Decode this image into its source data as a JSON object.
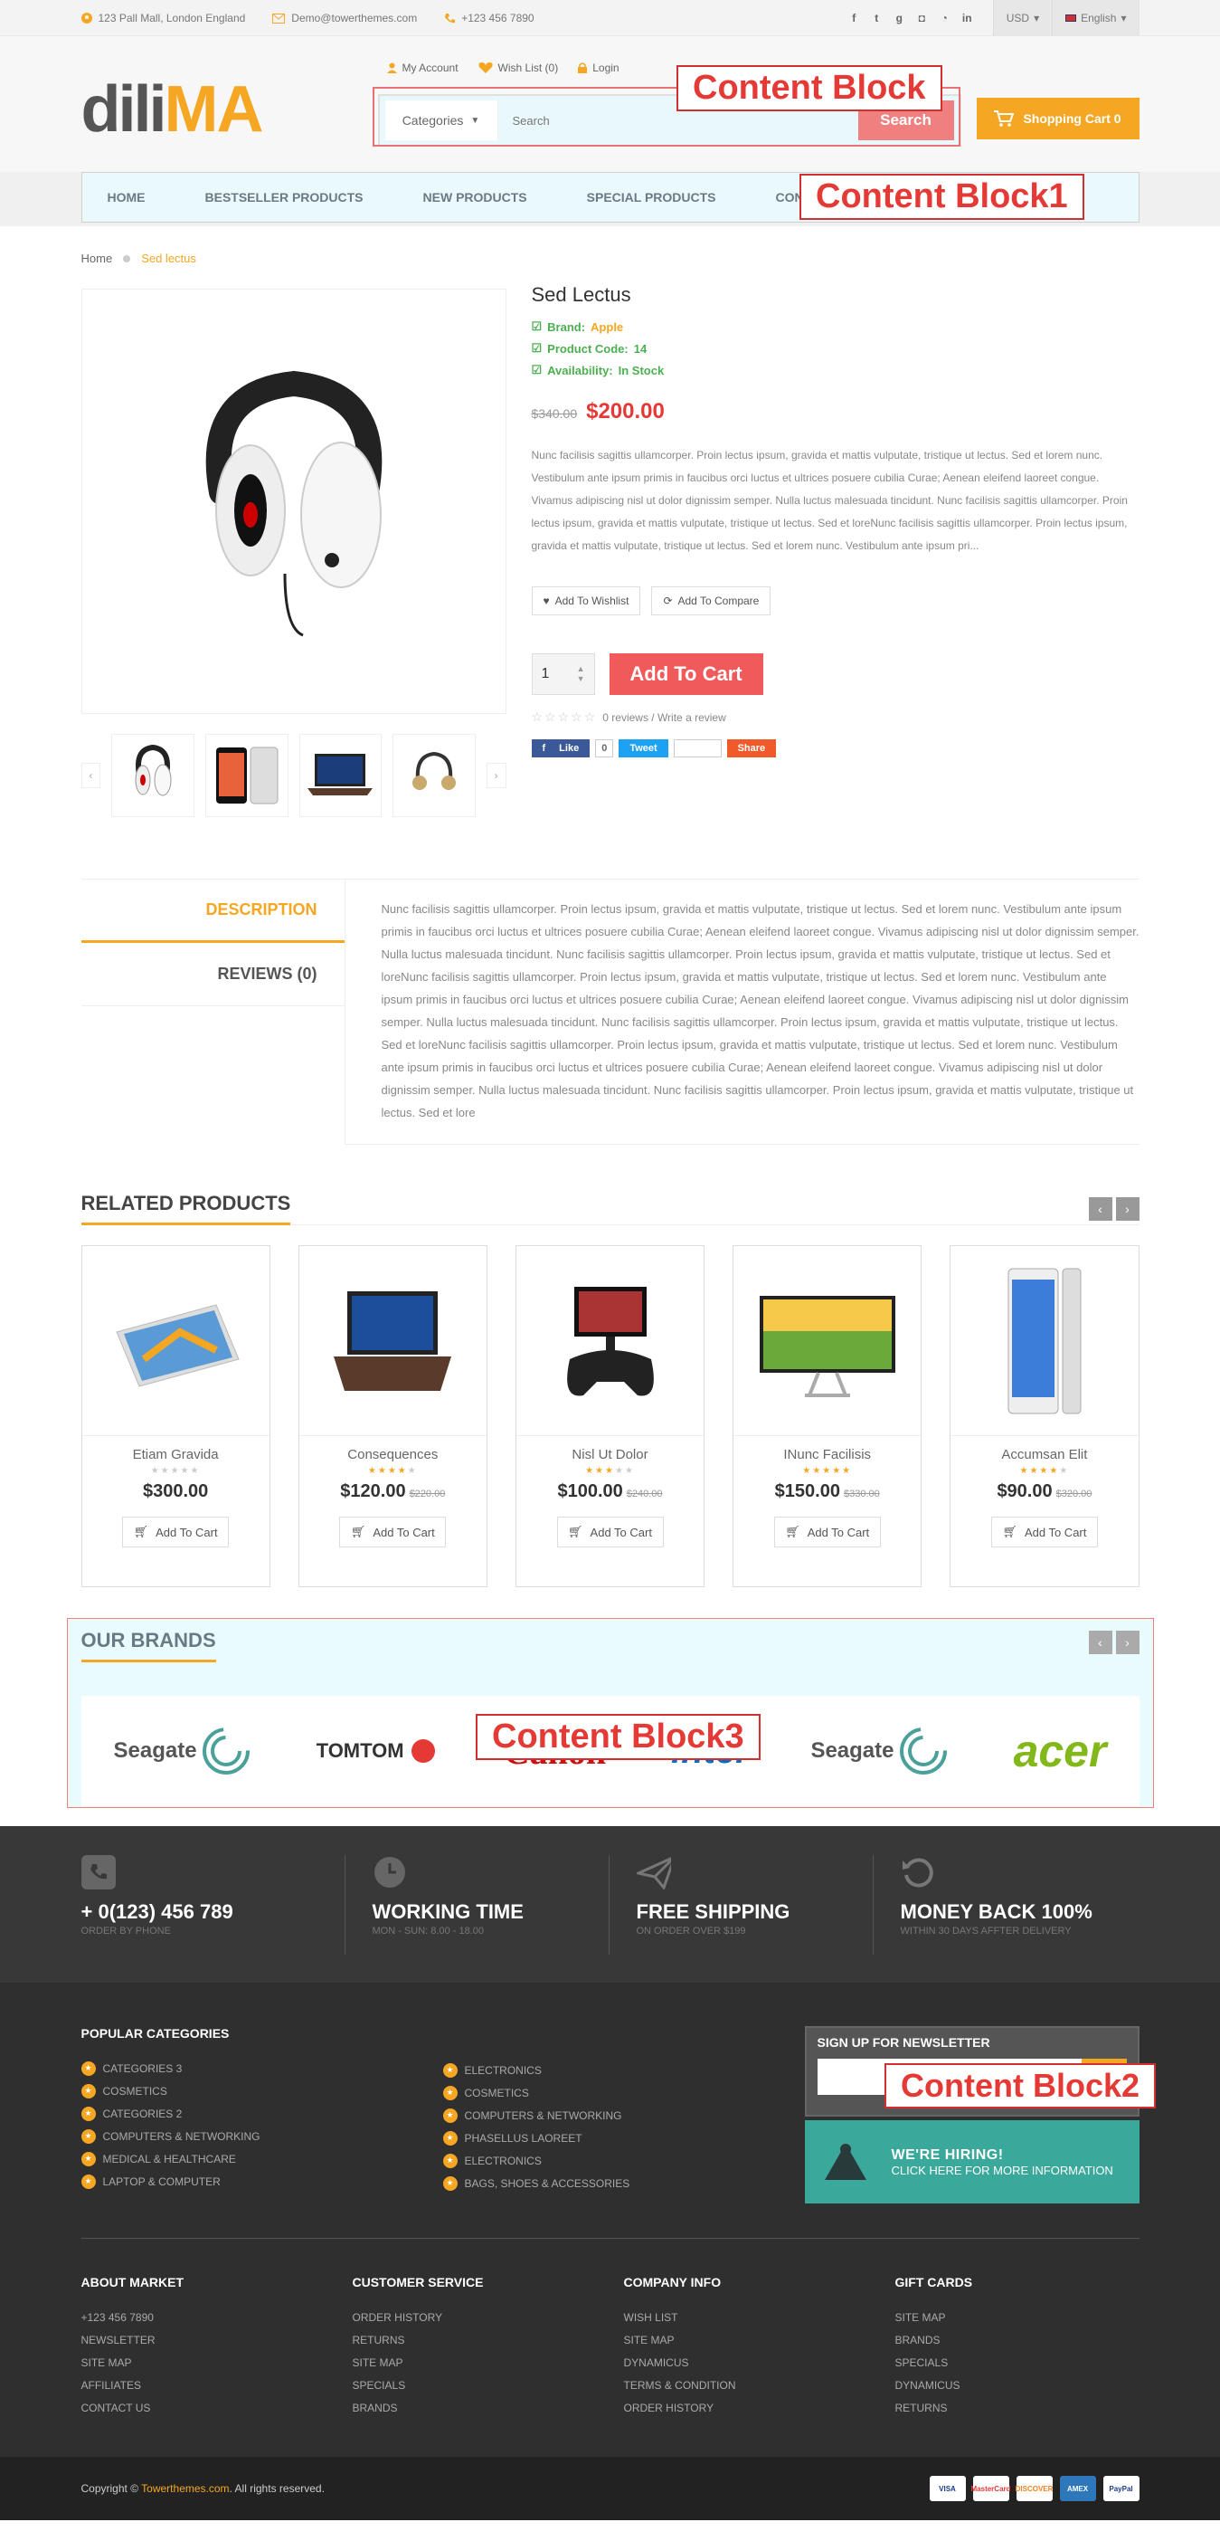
{
  "topbar": {
    "address": "123 Pall Mall, London England",
    "email": "Demo@towerthemes.com",
    "phone": "+123 456 7890",
    "currency": "USD",
    "language": "English",
    "social_icons": [
      "facebook-icon",
      "twitter-icon",
      "google-plus-icon",
      "instagram-icon",
      "rss-icon",
      "linkedin-icon"
    ]
  },
  "header": {
    "logo_text_a": "dili",
    "logo_text_b": "MA",
    "links": {
      "account": "My Account",
      "wishlist": "Wish List (0)",
      "login": "Login"
    },
    "search": {
      "category": "Categories",
      "placeholder": "Search",
      "button": "Search"
    },
    "cart": "Shopping Cart 0"
  },
  "nav": [
    "HOME",
    "BESTSELLER PRODUCTS",
    "NEW PRODUCTS",
    "SPECIAL PRODUCTS",
    "CONTACT US"
  ],
  "annotations": {
    "block": "Content Block",
    "block1": "Content Block1",
    "block2": "Content Block2",
    "block3": "Content Block3"
  },
  "breadcrumb": {
    "home": "Home",
    "current": "Sed lectus"
  },
  "product": {
    "title": "Sed Lectus",
    "brand_label": "Brand:",
    "brand": "Apple",
    "code_label": "Product Code:",
    "code": "14",
    "avail_label": "Availability:",
    "avail": "In Stock",
    "old_price": "$340.00",
    "price": "$200.00",
    "description": "Nunc facilisis sagittis ullamcorper. Proin lectus ipsum, gravida et mattis vulputate, tristique ut lectus. Sed et lorem nunc. Vestibulum ante ipsum primis in faucibus orci luctus et ultrices posuere cubilia Curae; Aenean eleifend laoreet congue. Vivamus adipiscing nisl ut dolor dignissim semper. Nulla luctus malesuada tincidunt. Nunc facilisis sagittis ullamcorper. Proin lectus ipsum, gravida et mattis vulputate, tristique ut lectus. Sed et loreNunc facilisis sagittis ullamcorper. Proin lectus ipsum, gravida et mattis vulputate, tristique ut lectus. Sed et lorem nunc. Vestibulum ante ipsum pri...",
    "wishlist_btn": "Add To Wishlist",
    "compare_btn": "Add To Compare",
    "qty": "1",
    "add_to_cart": "Add To Cart",
    "reviews": "0 reviews / Write a review",
    "rating": 0,
    "share": {
      "like": "Like",
      "like_count": "0",
      "tweet": "Tweet",
      "pin": "Pin it",
      "share": "Share"
    }
  },
  "tabs": {
    "description": "DESCRIPTION",
    "reviews": "REVIEWS (0)",
    "content": "Nunc facilisis sagittis ullamcorper. Proin lectus ipsum, gravida et mattis vulputate, tristique ut lectus. Sed et lorem nunc. Vestibulum ante ipsum primis in faucibus orci luctus et ultrices posuere cubilia Curae; Aenean eleifend laoreet congue. Vivamus adipiscing nisl ut dolor dignissim semper. Nulla luctus malesuada tincidunt. Nunc facilisis sagittis ullamcorper. Proin lectus ipsum, gravida et mattis vulputate, tristique ut lectus. Sed et loreNunc facilisis sagittis ullamcorper. Proin lectus ipsum, gravida et mattis vulputate, tristique ut lectus. Sed et lorem nunc. Vestibulum ante ipsum primis in faucibus orci luctus et ultrices posuere cubilia Curae; Aenean eleifend laoreet congue. Vivamus adipiscing nisl ut dolor dignissim semper. Nulla luctus malesuada tincidunt. Nunc facilisis sagittis ullamcorper. Proin lectus ipsum, gravida et mattis vulputate, tristique ut lectus. Sed et loreNunc facilisis sagittis ullamcorper. Proin lectus ipsum, gravida et mattis vulputate, tristique ut lectus. Sed et lorem nunc. Vestibulum ante ipsum primis in faucibus orci luctus et ultrices posuere cubilia Curae; Aenean eleifend laoreet congue. Vivamus adipiscing nisl ut dolor dignissim semper. Nulla luctus malesuada tincidunt. Nunc facilisis sagittis ullamcorper. Proin lectus ipsum, gravida et mattis vulputate, tristique ut lectus. Sed et lore"
  },
  "related": {
    "title": "RELATED PRODUCTS",
    "items": [
      {
        "name": "Etiam Gravida",
        "price": "$300.00",
        "old": "",
        "stars": 0,
        "btn": "Add To Cart"
      },
      {
        "name": "Consequences",
        "price": "$120.00",
        "old": "$220.00",
        "stars": 4,
        "btn": "Add To Cart"
      },
      {
        "name": "Nisl Ut Dolor",
        "price": "$100.00",
        "old": "$240.00",
        "stars": 3,
        "btn": "Add To Cart"
      },
      {
        "name": "INunc Facilisis",
        "price": "$150.00",
        "old": "$330.00",
        "stars": 5,
        "btn": "Add To Cart"
      },
      {
        "name": "Accumsan Elit",
        "price": "$90.00",
        "old": "$320.00",
        "stars": 4,
        "btn": "Add To Cart"
      }
    ]
  },
  "brands": {
    "title": "OUR BRANDS",
    "items": [
      "Seagate",
      "TOMTOM",
      "Canon",
      "intel",
      "Seagate",
      "acer"
    ]
  },
  "features": [
    {
      "title": "+ 0(123) 456 789",
      "sub": "ORDER BY PHONE",
      "icon": "phone-icon"
    },
    {
      "title": "WORKING TIME",
      "sub": "MON - SUN: 8.00 - 18.00",
      "icon": "clock-icon"
    },
    {
      "title": "FREE SHIPPING",
      "sub": "ON ORDER OVER $199",
      "icon": "paper-plane-icon"
    },
    {
      "title": "MONEY BACK 100%",
      "sub": "WITHIN 30 DAYS AFFTER DELIVERY",
      "icon": "undo-icon"
    }
  ],
  "footer": {
    "popular_title": "POPULAR CATEGORIES",
    "popular_a": [
      "CATEGORIES 3",
      "COSMETICS",
      "CATEGORIES 2",
      "COMPUTERS & NETWORKING",
      "MEDICAL & HEALTHCARE",
      "LAPTOP & COMPUTER"
    ],
    "popular_b": [
      "ELECTRONICS",
      "COSMETICS",
      "COMPUTERS & NETWORKING",
      "PHASELLUS LAOREET",
      "ELECTRONICS",
      "BAGS, SHOES & ACCESSORIES"
    ],
    "newsletter_title": "SIGN UP FOR NEWSLETTER",
    "hiring_title": "WE'RE HIRING!",
    "hiring_sub": "CLICK HERE FOR MORE INFORMATION",
    "about_title": "ABOUT MARKET",
    "about": [
      "+123 456 7890",
      "NEWSLETTER",
      "SITE MAP",
      "AFFILIATES",
      "CONTACT US"
    ],
    "service_title": "CUSTOMER SERVICE",
    "service": [
      "ORDER HISTORY",
      "RETURNS",
      "SITE MAP",
      "SPECIALS",
      "BRANDS"
    ],
    "company_title": "COMPANY INFO",
    "company": [
      "WISH LIST",
      "SITE MAP",
      "DYNAMICUS",
      "TERMS & CONDITION",
      "ORDER HISTORY"
    ],
    "gift_title": "GIFT CARDS",
    "gift": [
      "SITE MAP",
      "BRANDS",
      "SPECIALS",
      "DYNAMICUS",
      "RETURNS"
    ],
    "copyright_pre": "Copyright ©",
    "copyright_site": "Towerthemes.com",
    "copyright_post": ". All rights reserved.",
    "payment": [
      "VISA",
      "MasterCard",
      "DISCOVER",
      "AMEX",
      "PayPal"
    ]
  },
  "colors": {
    "accent": "#f5a623",
    "sale": "#e53935",
    "cta": "#f05a5a",
    "stock": "#4caf50",
    "footer": "#2f2f2f"
  }
}
